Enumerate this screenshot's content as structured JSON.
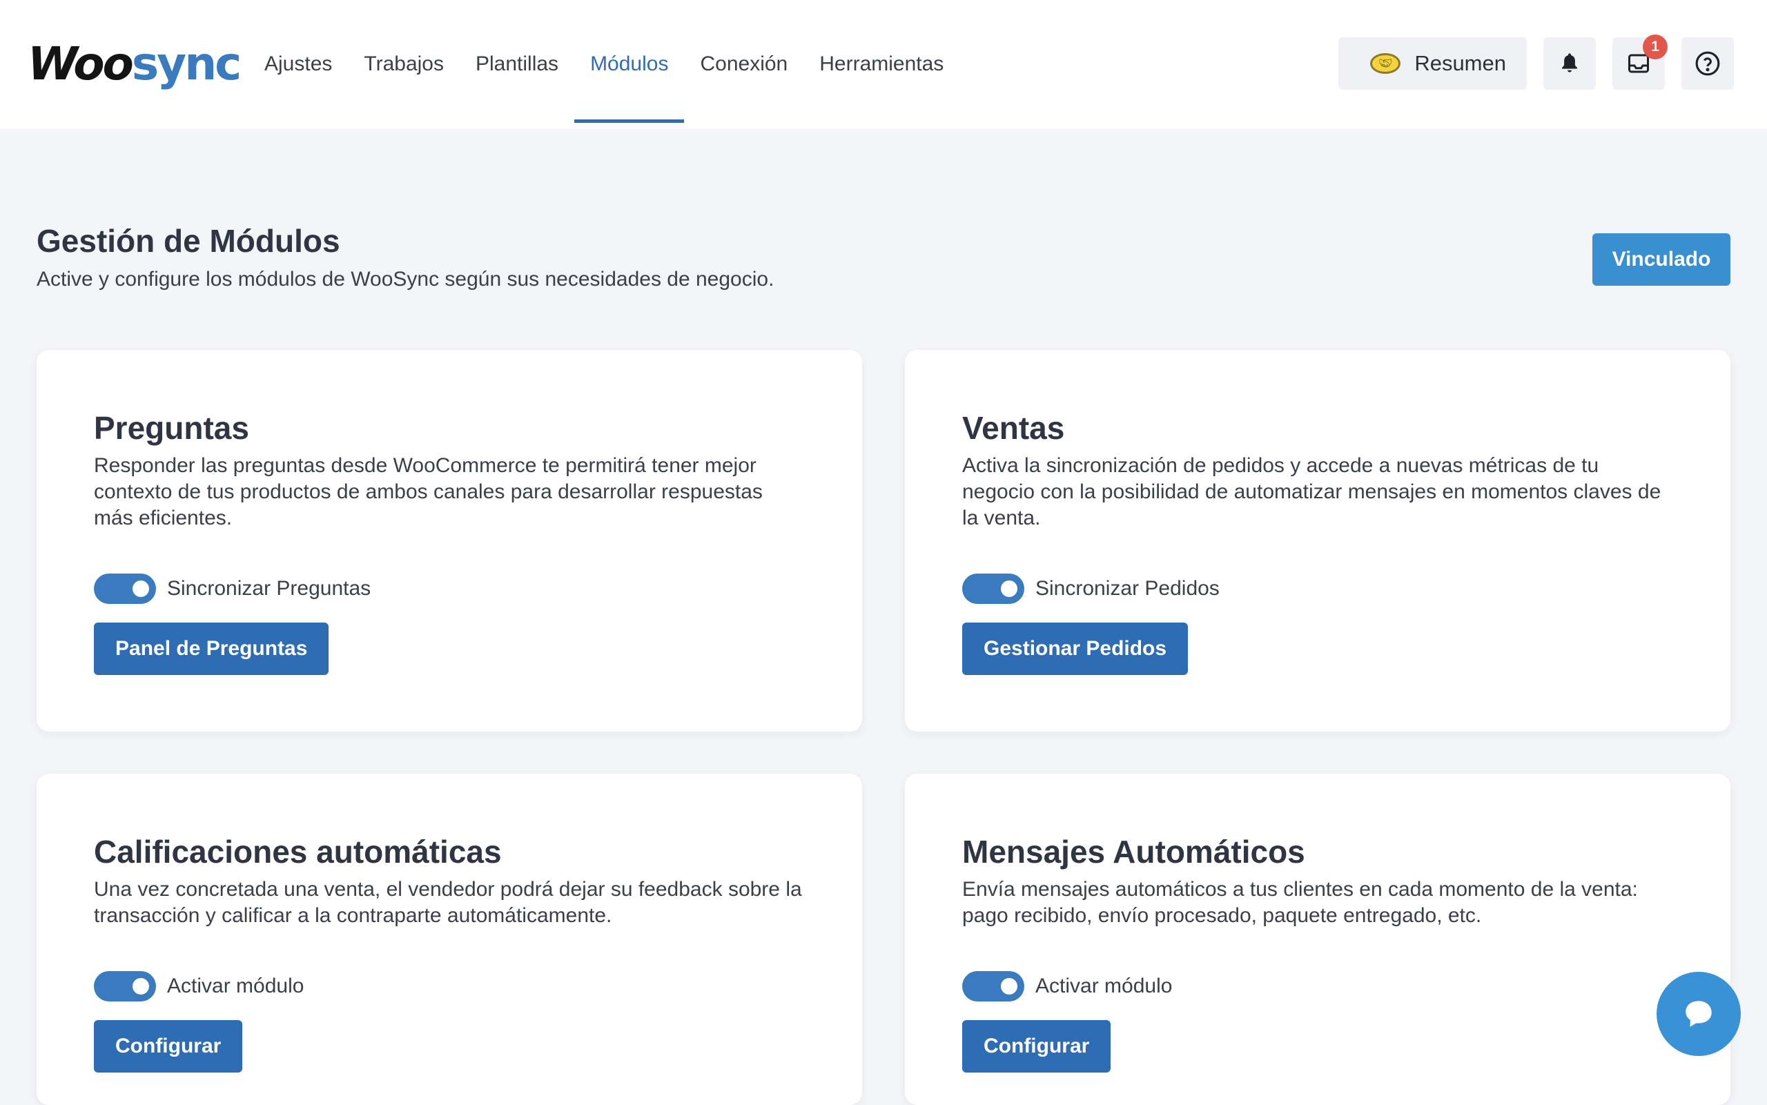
{
  "brand": {
    "logo_part1": "Woo",
    "logo_part2": "sync"
  },
  "nav": {
    "items": [
      {
        "label": "Ajustes"
      },
      {
        "label": "Trabajos"
      },
      {
        "label": "Plantillas"
      },
      {
        "label": "Módulos",
        "active": true
      },
      {
        "label": "Conexión"
      },
      {
        "label": "Herramientas"
      }
    ]
  },
  "header_actions": {
    "resumen_label": "Resumen",
    "resumen_icon": "handshake-icon",
    "notifications_icon": "bell-icon",
    "inbox_icon": "inbox-icon",
    "inbox_badge": "1",
    "help_icon": "help-icon"
  },
  "page": {
    "title": "Gestión de Módulos",
    "subtitle": "Active y configure los módulos de WooSync según sus necesidades de negocio.",
    "status_button": "Vinculado"
  },
  "modules": [
    {
      "title": "Preguntas",
      "description": "Responder las preguntas desde WooCommerce te permitirá tener mejor contexto de tus productos de ambos canales para desarrollar respuestas más eficientes.",
      "toggle_label": "Sincronizar Preguntas",
      "toggle_on": true,
      "button_label": "Panel de Preguntas"
    },
    {
      "title": "Ventas",
      "description": "Activa la sincronización de pedidos y accede a nuevas métricas de tu negocio con la posibilidad de automatizar mensajes en momentos claves de la venta.",
      "toggle_label": "Sincronizar Pedidos",
      "toggle_on": true,
      "button_label": "Gestionar Pedidos"
    },
    {
      "title": "Calificaciones automáticas",
      "description": "Una vez concretada una venta, el vendedor podrá dejar su feedback sobre la transacción y calificar a la contraparte automáticamente.",
      "toggle_label": "Activar módulo",
      "toggle_on": true,
      "button_label": "Configurar"
    },
    {
      "title": "Mensajes Automáticos",
      "description": "Envía mensajes automáticos a tus clientes en cada momento de la venta: pago recibido, envío procesado, paquete entregado, etc.",
      "toggle_label": "Activar módulo",
      "toggle_on": true,
      "button_label": "Configurar"
    }
  ],
  "chat_widget_icon": "chat-icon",
  "colors": {
    "primary": "#2e6db4",
    "status_button": "#3a8fd0",
    "badge": "#e2574c",
    "background": "#f3f5f9"
  }
}
